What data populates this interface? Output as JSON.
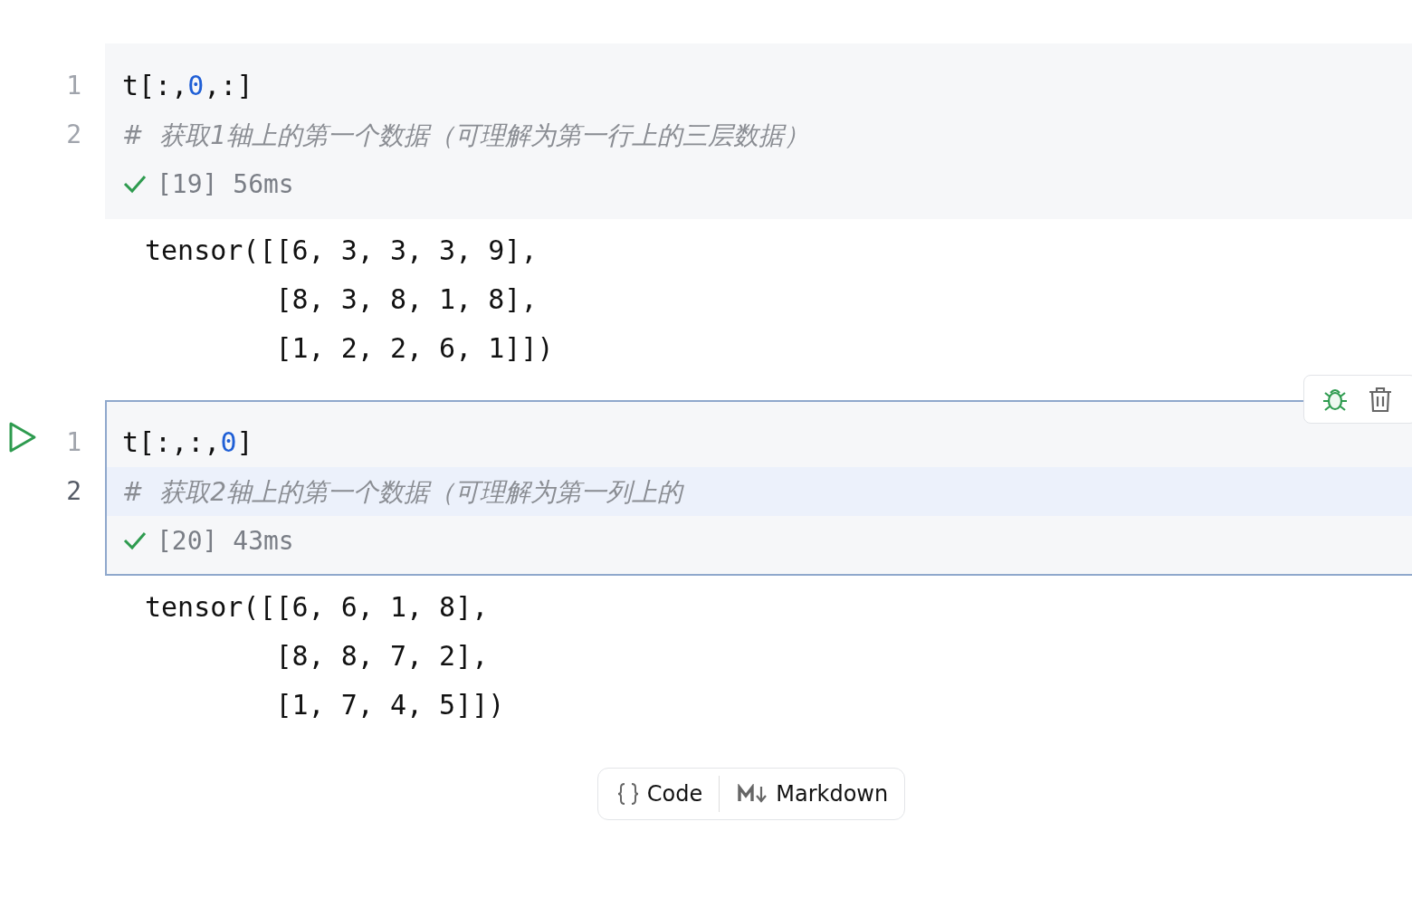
{
  "cells": [
    {
      "selected": false,
      "lines": [
        {
          "number": "1",
          "current": false,
          "tokens": [
            {
              "kind": "plain",
              "text": "t[:,"
            },
            {
              "kind": "number",
              "text": "0"
            },
            {
              "kind": "plain",
              "text": ",:]"
            }
          ]
        },
        {
          "number": "2",
          "current": false,
          "tokens": [
            {
              "kind": "comment",
              "text": "#  获取1轴上的第一个数据（可理解为第一行上的三层数据）"
            }
          ]
        }
      ],
      "status": {
        "success": true,
        "text": "[19] 56ms"
      },
      "output": [
        "tensor([[6, 3, 3, 3, 9],",
        "        [8, 3, 8, 1, 8],",
        "        [1, 2, 2, 6, 1]])"
      ]
    },
    {
      "selected": true,
      "lines": [
        {
          "number": "1",
          "current": false,
          "tokens": [
            {
              "kind": "plain",
              "text": "t[:,:,"
            },
            {
              "kind": "number",
              "text": "0"
            },
            {
              "kind": "plain",
              "text": "]"
            }
          ]
        },
        {
          "number": "2",
          "current": true,
          "tokens": [
            {
              "kind": "comment",
              "text": "#  获取2轴上的第一个数据（可理解为第一列上的"
            }
          ]
        }
      ],
      "status": {
        "success": true,
        "text": "[20] 43ms"
      },
      "output": [
        "tensor([[6, 6, 1, 8],",
        "        [8, 8, 7, 2],",
        "        [1, 7, 4, 5]])"
      ]
    }
  ],
  "add_buttons": [
    {
      "kind": "code",
      "label": "Code"
    },
    {
      "kind": "markdown",
      "label": "Markdown"
    }
  ]
}
